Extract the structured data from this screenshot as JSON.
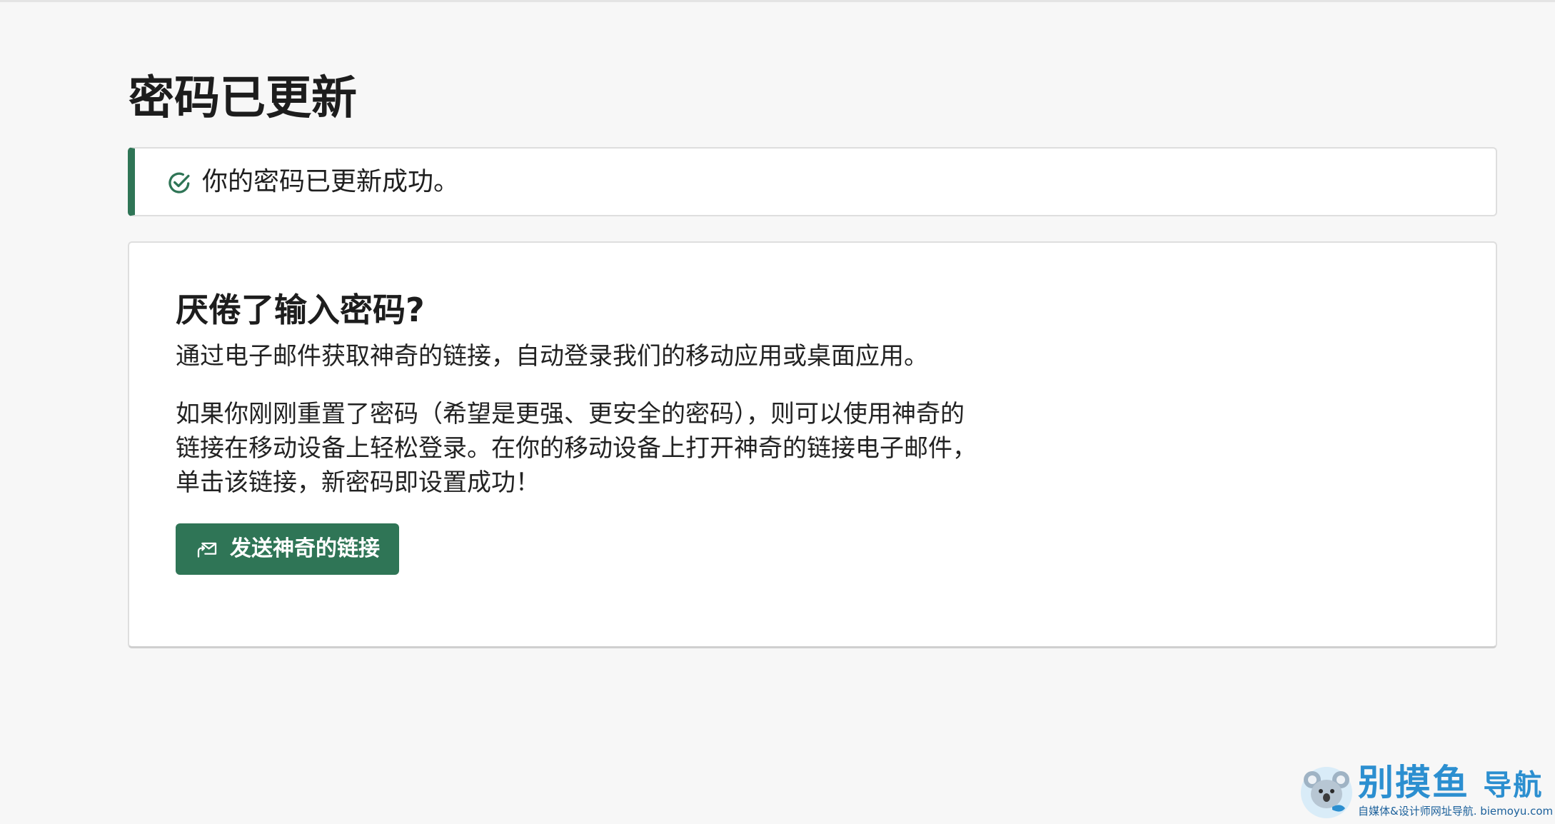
{
  "page": {
    "title": "密码已更新"
  },
  "alert": {
    "icon": "check-circle-icon",
    "message": "你的密码已更新成功。",
    "accent_color": "#2f7556"
  },
  "card": {
    "heading": "厌倦了输入密码?",
    "subtitle": "通过电子邮件获取神奇的链接，自动登录我们的移动应用或桌面应用。",
    "body": "如果你刚刚重置了密码（希望是更强、更安全的密码），则可以使用神奇的链接在移动设备上轻松登录。在你的移动设备上打开神奇的链接电子邮件，单击该链接，新密码即设置成功！",
    "button": {
      "label": "发送神奇的链接",
      "icon": "mail-send-icon",
      "color": "#2f7556"
    }
  },
  "watermark": {
    "name": "别摸鱼",
    "name_suffix": "导航",
    "tagline": "自媒体&设计师网址导航. biemoyu.com",
    "color": "#2c8fd0"
  }
}
